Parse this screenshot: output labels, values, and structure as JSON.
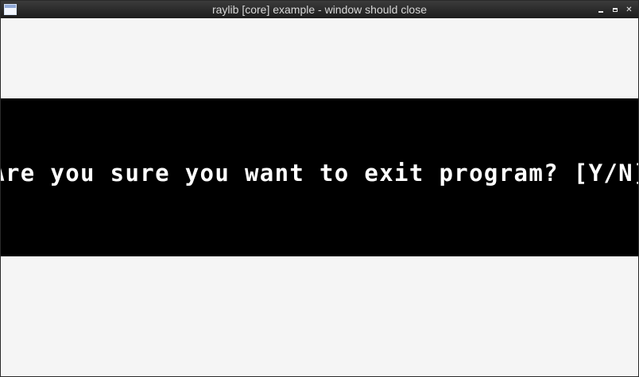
{
  "window": {
    "title": "raylib [core] example - window should close",
    "close_symbol": "✕"
  },
  "dialog": {
    "message": "Are you sure you want to exit program? [Y/N]"
  },
  "icons": {
    "app": "app-window-icon",
    "minimize": "minimize-icon",
    "maximize": "maximize-icon",
    "close": "close-icon"
  },
  "colors": {
    "titlebar": "#1d1d1d",
    "title_text": "#d8d8d8",
    "background": "#f5f5f5",
    "dialog_band": "#000000",
    "dialog_text": "#ffffff"
  }
}
